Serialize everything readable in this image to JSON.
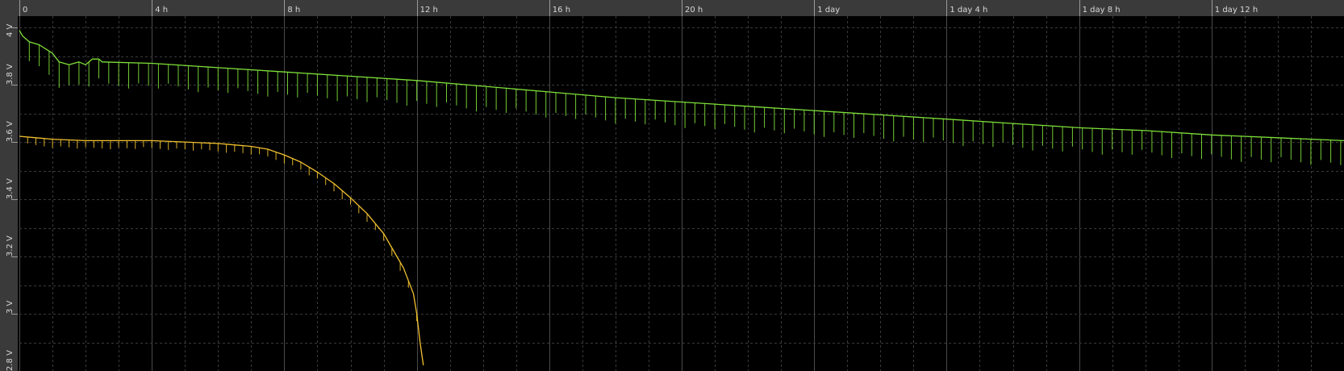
{
  "chart_data": {
    "type": "line",
    "title": "",
    "xlabel": "",
    "ylabel": "",
    "xlim": [
      0,
      40.0
    ],
    "ylim": [
      2.8,
      4.04
    ],
    "x_unit": "hours",
    "grid": true,
    "legend": "none",
    "x_ticks": [
      {
        "value": 0,
        "label": "0"
      },
      {
        "value": 4,
        "label": "4 h"
      },
      {
        "value": 8,
        "label": "8 h"
      },
      {
        "value": 12,
        "label": "12 h"
      },
      {
        "value": 16,
        "label": "16 h"
      },
      {
        "value": 20,
        "label": "20 h"
      },
      {
        "value": 24,
        "label": "1 day"
      },
      {
        "value": 28,
        "label": "1 day 4 h"
      },
      {
        "value": 32,
        "label": "1 day 8 h"
      },
      {
        "value": 36,
        "label": "1 day 12 h"
      }
    ],
    "y_ticks": [
      {
        "value": 4.0,
        "label": "4 V"
      },
      {
        "value": 3.8,
        "label": "3.8 V"
      },
      {
        "value": 3.6,
        "label": "3.6 V"
      },
      {
        "value": 3.4,
        "label": "3.4 V"
      },
      {
        "value": 3.2,
        "label": "3.2 V"
      },
      {
        "value": 3.0,
        "label": "3 V"
      },
      {
        "value": 2.8,
        "label": "2.8 V"
      }
    ],
    "series": [
      {
        "color": "#7fe03a",
        "x": [
          0,
          0.1,
          0.3,
          0.6,
          1.0,
          1.2,
          1.5,
          1.8,
          2.0,
          2.2,
          2.4,
          2.5,
          4,
          6,
          8,
          10,
          12,
          14,
          16,
          18,
          20,
          22,
          24,
          26,
          28,
          30,
          32,
          34,
          36,
          38,
          40.0
        ],
        "y": [
          3.99,
          3.97,
          3.95,
          3.94,
          3.91,
          3.88,
          3.87,
          3.88,
          3.87,
          3.89,
          3.89,
          3.88,
          3.875,
          3.86,
          3.845,
          3.83,
          3.815,
          3.795,
          3.775,
          3.755,
          3.74,
          3.725,
          3.71,
          3.695,
          3.68,
          3.665,
          3.65,
          3.64,
          3.625,
          3.615,
          3.605
        ],
        "spike_depth_v": 0.09,
        "spike_interval_h": 0.3
      },
      {
        "color": "#f2c12e",
        "x": [
          0,
          0.5,
          1,
          2,
          3,
          4,
          5,
          6,
          6.5,
          7,
          7.5,
          8,
          8.5,
          9,
          9.5,
          10,
          10.5,
          11,
          11.3,
          11.6,
          11.9,
          12.0,
          12.1,
          12.2
        ],
        "y": [
          3.62,
          3.615,
          3.61,
          3.605,
          3.605,
          3.605,
          3.6,
          3.595,
          3.59,
          3.585,
          3.575,
          3.555,
          3.53,
          3.495,
          3.455,
          3.405,
          3.35,
          3.28,
          3.22,
          3.16,
          3.07,
          3.0,
          2.9,
          2.82
        ],
        "spike_depth_v": 0.03,
        "spike_interval_h": 0.25
      }
    ]
  }
}
